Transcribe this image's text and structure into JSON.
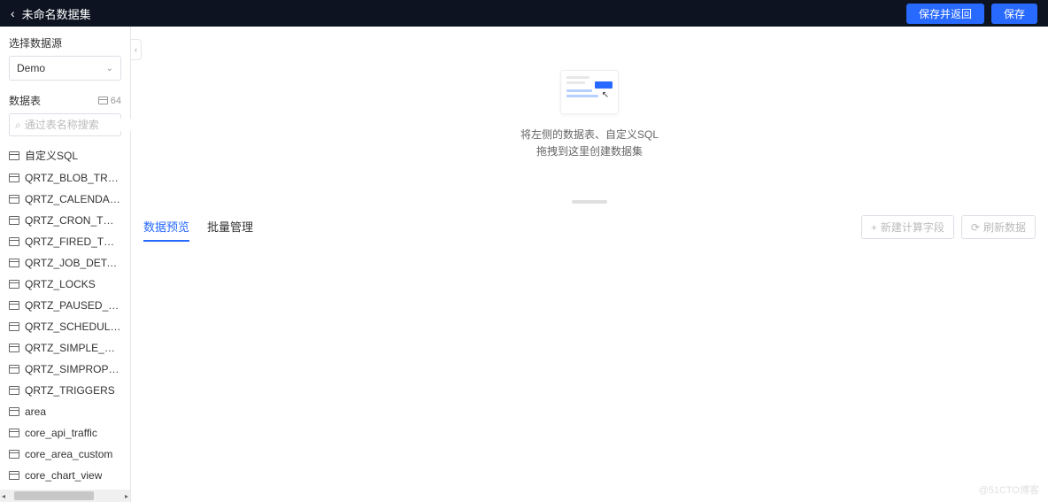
{
  "header": {
    "title": "未命名数据集",
    "save_and_return": "保存并返回",
    "save": "保存"
  },
  "sidebar": {
    "datasource_label": "选择数据源",
    "datasource_value": "Demo",
    "table_label": "数据表",
    "table_count": "64",
    "search_placeholder": "通过表名称搜索",
    "custom_sql": "自定义SQL",
    "tables": [
      "QRTZ_BLOB_TRIGGERS",
      "QRTZ_CALENDARS",
      "QRTZ_CRON_TRIGGERS",
      "QRTZ_FIRED_TRIGGERS",
      "QRTZ_JOB_DETAILS",
      "QRTZ_LOCKS",
      "QRTZ_PAUSED_TRIGGER_...",
      "QRTZ_SCHEDULER_STATE",
      "QRTZ_SIMPLE_TRIGGERS",
      "QRTZ_SIMPROP_TRIGGERS",
      "QRTZ_TRIGGERS",
      "area",
      "core_api_traffic",
      "core_area_custom",
      "core_chart_view"
    ]
  },
  "drop": {
    "hint_line1": "将左侧的数据表、自定义SQL",
    "hint_line2": "拖拽到这里创建数据集"
  },
  "content": {
    "tabs": [
      {
        "label": "数据预览",
        "active": true
      },
      {
        "label": "批量管理",
        "active": false
      }
    ],
    "new_calc_field": "新建计算字段",
    "refresh": "刷新数据"
  },
  "watermark": "@51CTO博客"
}
